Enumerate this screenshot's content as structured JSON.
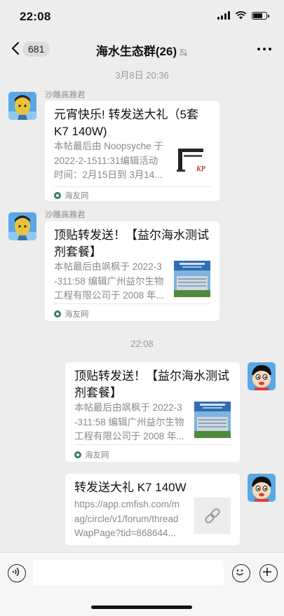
{
  "status_bar": {
    "time": "22:08"
  },
  "nav": {
    "unread_count": "681",
    "title": "海水生态群(26)"
  },
  "messages": [
    {
      "timestamp": "3月8日 20:36",
      "sender": "沙雕高雅君",
      "card": {
        "title": "元宵快乐! 转发送大礼（5套K7  140W)",
        "description": "本帖最后由 Noopsyche 于\n2022-2-1511:31编辑活动\n时间：2月15日到 3月14...",
        "source": "海友网"
      }
    },
    {
      "sender": "沙雕高雅君",
      "card": {
        "title": "顶贴转发送！【益尔海水测试剂套餐】",
        "description": "本帖最后由飒枫于 2022-3\n-311:58 编辑广州益尔生物\n工程有限公司于 2008 年...",
        "source": "海友网"
      }
    },
    {
      "timestamp": "22:08",
      "card": {
        "title": "顶贴转发送！【益尔海水测试剂套餐】",
        "description": "本帖最后由飒枫于 2022-3\n-311:58 编辑广州益尔生物\n工程有限公司于 2008 年...",
        "source": "海友网"
      }
    },
    {
      "card": {
        "title": "转发送大礼 K7 140W",
        "description": "https://app.cmfish.com/m\nag/circle/v1/forum/thread\nWapPage?tid=868644..."
      }
    }
  ]
}
